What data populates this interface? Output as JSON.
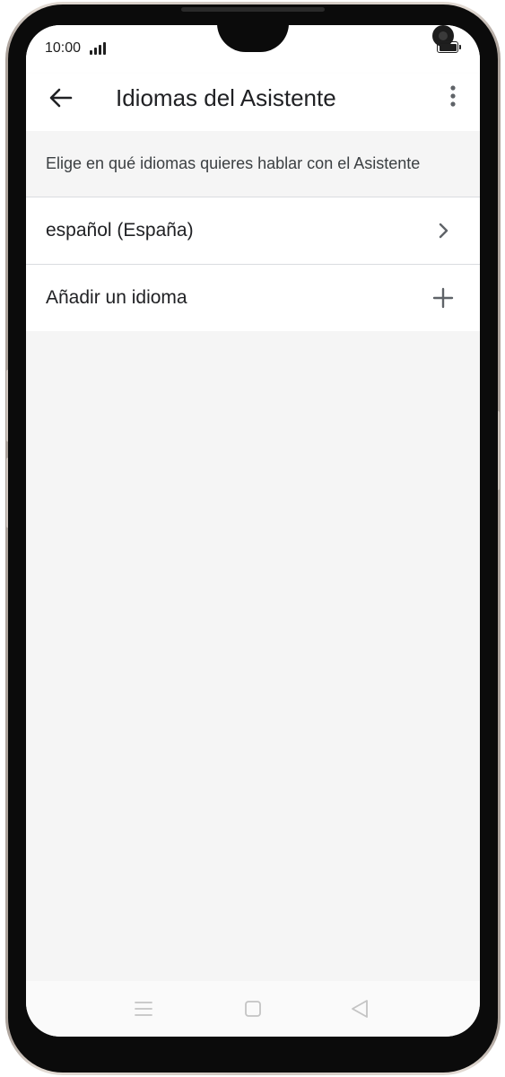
{
  "status_bar": {
    "time": "10:00"
  },
  "app_bar": {
    "back_icon": "arrow-back-icon",
    "title": "Idiomas del Asistente",
    "more_icon": "more-vert-icon"
  },
  "description": "Elige en qué idiomas quieres hablar con el Asistente",
  "languages": [
    {
      "label": "español (España)",
      "icon": "chevron-right-icon"
    },
    {
      "label": "Añadir un idioma",
      "icon": "add-icon"
    }
  ],
  "nav_bar": {
    "icons": [
      "menu-icon",
      "home-square-icon",
      "back-triangle-icon"
    ]
  },
  "colors": {
    "surface": "#ffffff",
    "background": "#f5f5f5",
    "text_primary": "#202124",
    "text_secondary": "#3c4043",
    "divider": "#dadce0",
    "icon": "#5f6368",
    "nav_icon": "#c4c4c4"
  }
}
